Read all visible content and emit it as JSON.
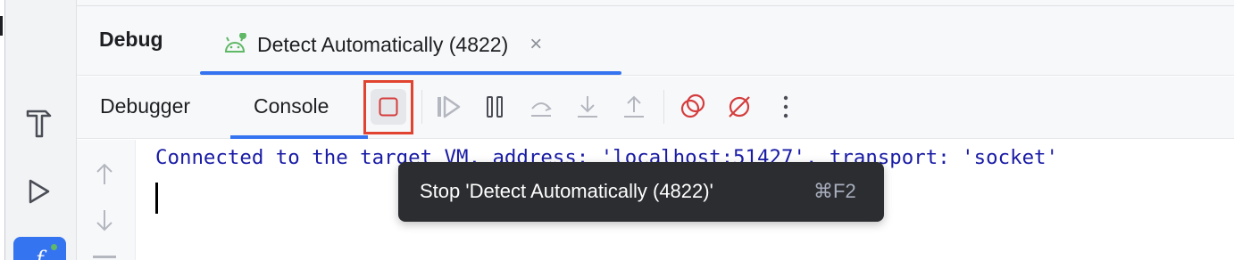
{
  "header": {
    "panel_title": "Debug",
    "run_tab_label": "Detect Automatically (4822)",
    "run_tab_close": "×",
    "run_tab_icon": "android-icon"
  },
  "toolbar": {
    "tabs": [
      {
        "label": "Debugger"
      },
      {
        "label": "Console",
        "active": true
      }
    ],
    "buttons": [
      {
        "name": "stop-button",
        "icon": "stop-icon",
        "highlighted": true
      },
      {
        "name": "resume-button",
        "icon": "resume-icon"
      },
      {
        "name": "pause-button",
        "icon": "pause-icon"
      },
      {
        "name": "step-over-button",
        "icon": "step-over-icon"
      },
      {
        "name": "step-into-button",
        "icon": "step-into-icon"
      },
      {
        "name": "step-out-button",
        "icon": "step-out-icon"
      },
      {
        "name": "view-breakpoints-button",
        "icon": "breakpoints-icon"
      },
      {
        "name": "mute-breakpoints-button",
        "icon": "mute-breakpoints-icon"
      },
      {
        "name": "more-options-button",
        "icon": "more-vertical-icon"
      }
    ]
  },
  "console": {
    "line1": "Connected to the target VM, address: 'localhost:51427', transport: 'socket'"
  },
  "tooltip": {
    "text": "Stop 'Detect Automatically (4822)'",
    "shortcut": "⌘F2"
  },
  "sidebar": {
    "items": [
      {
        "icon": "build-hammer-icon"
      },
      {
        "icon": "run-icon"
      },
      {
        "icon": "app-quality-icon"
      }
    ]
  },
  "colors": {
    "accent": "#3574f0",
    "stop_highlight": "#e0432f",
    "console_text": "#1a1ca6",
    "tooltip_bg": "#2b2d30"
  }
}
